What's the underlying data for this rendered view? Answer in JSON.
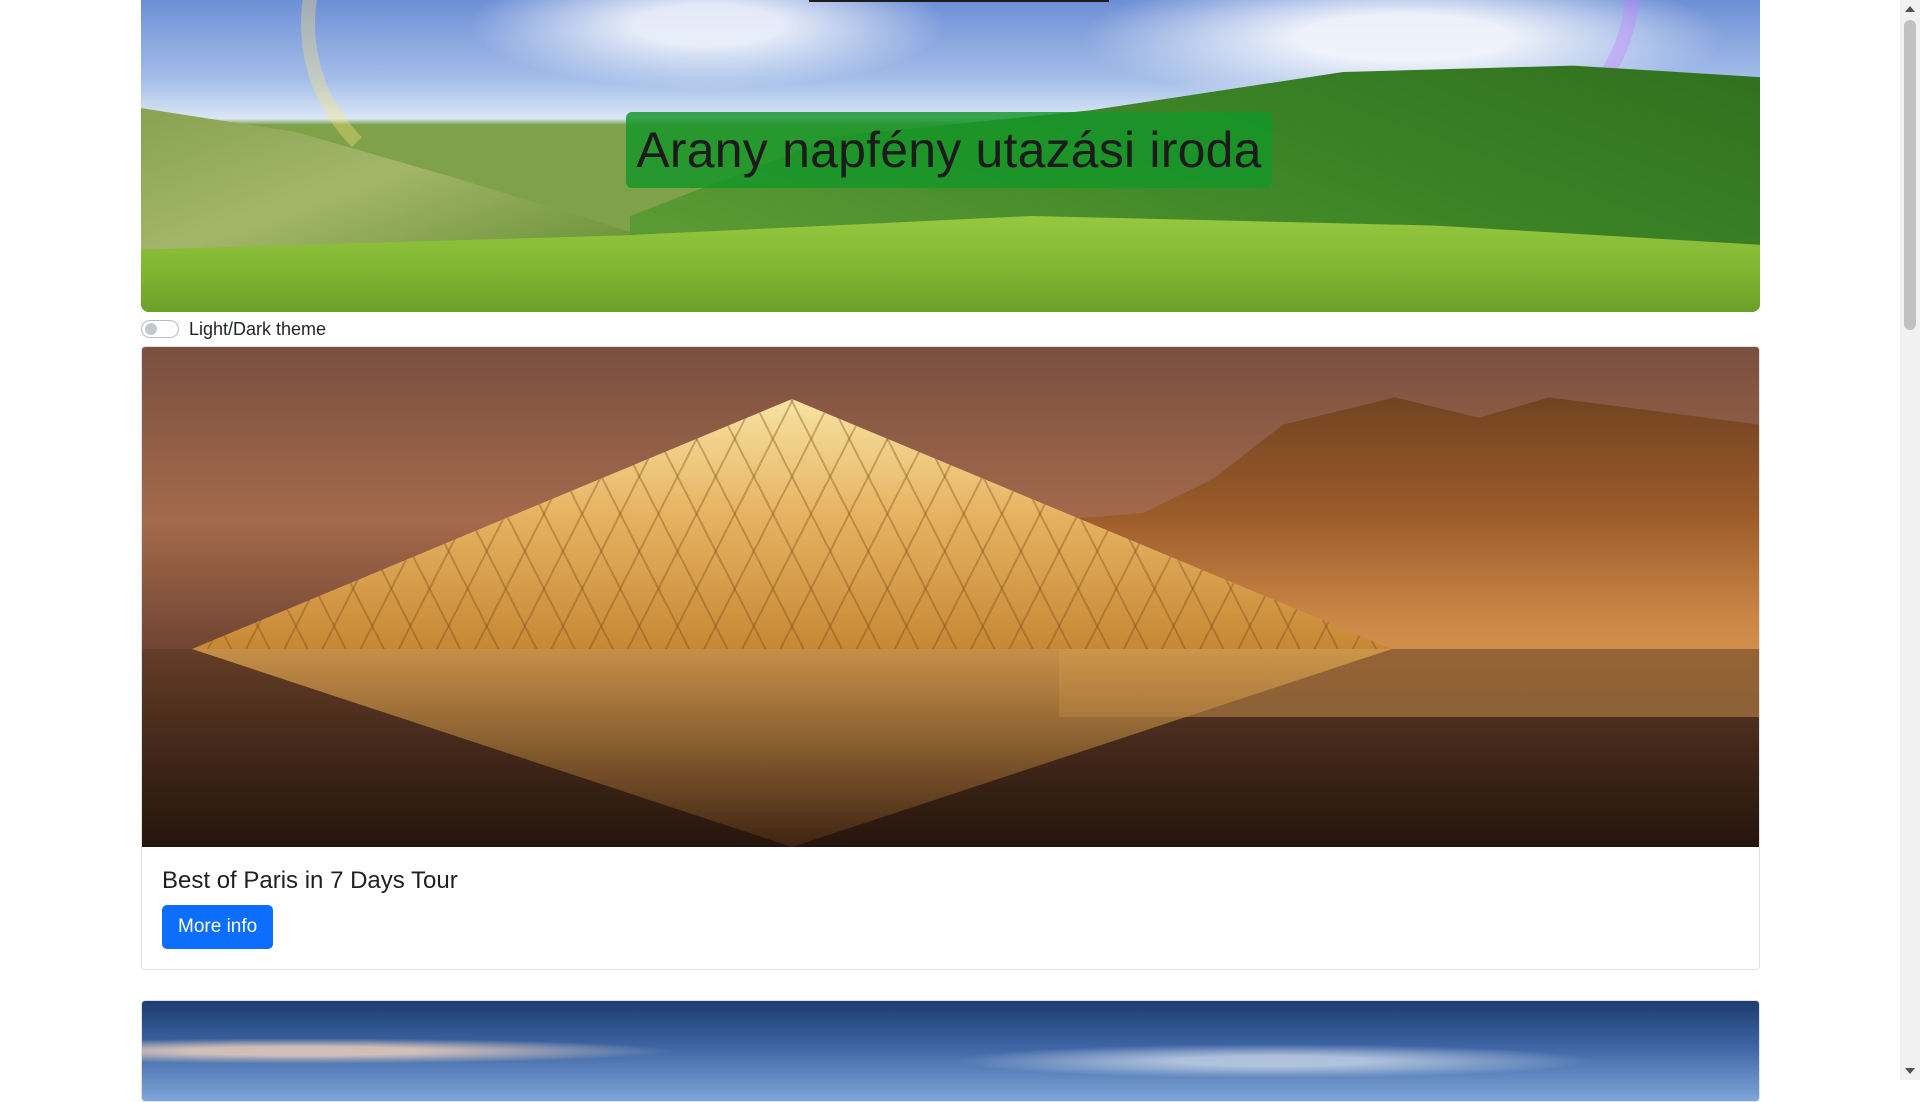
{
  "header": {
    "title": "Arany napfény utazási iroda"
  },
  "theme_toggle": {
    "label": "Light/Dark theme",
    "checked": false
  },
  "cards": [
    {
      "title": "Best of Paris in 7 Days Tour",
      "button_label": "More info"
    }
  ],
  "colors": {
    "primary_button": "#0d6efd",
    "title_badge": "#149628"
  }
}
